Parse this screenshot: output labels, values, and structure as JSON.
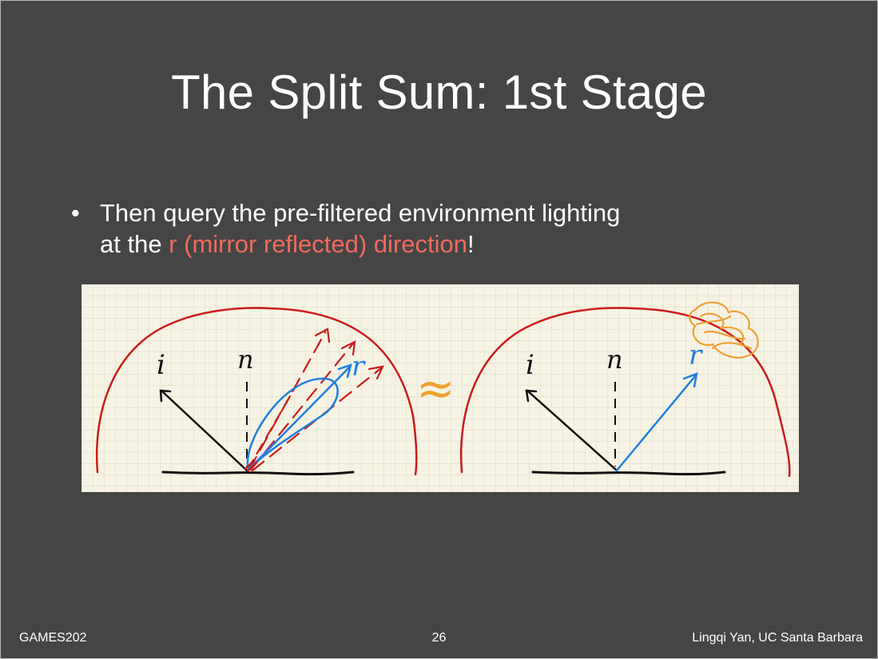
{
  "slide": {
    "title": "The Split Sum: 1st Stage",
    "bullet": {
      "marker": "•",
      "line1": "Then query the pre-filtered environment lighting",
      "line2_prefix": "at the ",
      "line2_highlight": "r (mirror reflected) direction",
      "line2_suffix": "!"
    },
    "figure": {
      "left_labels": {
        "incident": "i",
        "normal": "n",
        "reflect": "r"
      },
      "approx_symbol": "≈",
      "right_labels": {
        "incident": "i",
        "normal": "n",
        "reflect": "r"
      }
    },
    "footer": {
      "left": "GAMES202",
      "page_number": "26",
      "right": "Lingqi Yan, UC Santa Barbara"
    }
  },
  "colors": {
    "background": "#454545",
    "highlight": "#f26b5b",
    "paper": "#f6f3e4",
    "grid": "#dcd9cc",
    "hemisphere": "#cc1b1b",
    "blue": "#1e7fe0",
    "red_dashed": "#cc1b1b",
    "orange": "#f0a030",
    "ink": "#111111"
  }
}
